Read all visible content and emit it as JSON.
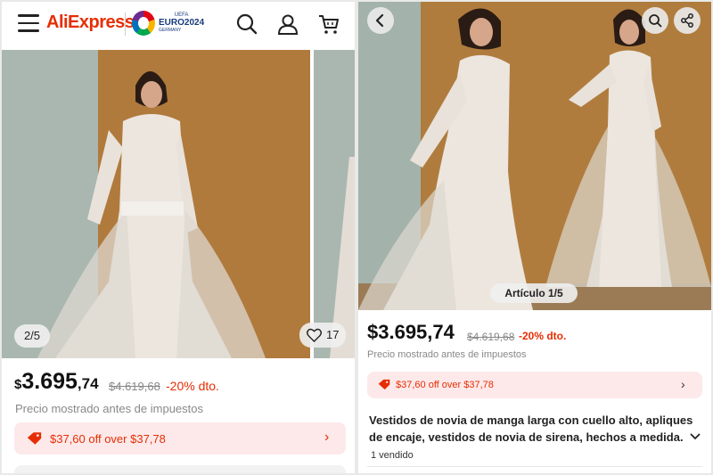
{
  "left": {
    "logo": "AliExpress",
    "euro": {
      "top": "UEFA",
      "name": "EURO2024",
      "sub": "GERMANY"
    },
    "image_counter": "2/5",
    "wishlist_count": "17",
    "price": {
      "currency": "$",
      "integer": "3.695",
      "decimal": ",74"
    },
    "original_price": "$4.619,68",
    "discount": "-20% dto.",
    "price_note": "Precio mostrado antes de impuestos",
    "coupon": "$37,60 off over $37,78"
  },
  "right": {
    "image_label": "Artículo 1/5",
    "price": "$3.695,74",
    "original_price": "$4.619,68",
    "discount": "-20% dto.",
    "price_note": "Precio mostrado antes de impuestos",
    "coupon": "$37,60 off over $37,78",
    "title": "Vestidos de novia de manga larga con cuello alto, apliques de encaje, vestidos de novia de sirena, hechos a medida.",
    "sold": "1 vendido"
  },
  "colors": {
    "brand": "#e62e04",
    "coupon_bg": "#fde9ea"
  },
  "icons": [
    "menu-icon",
    "search-icon",
    "user-icon",
    "cart-icon",
    "heart-icon",
    "tag-icon",
    "chevron-right-icon",
    "back-icon",
    "share-icon",
    "chevron-down-icon"
  ]
}
